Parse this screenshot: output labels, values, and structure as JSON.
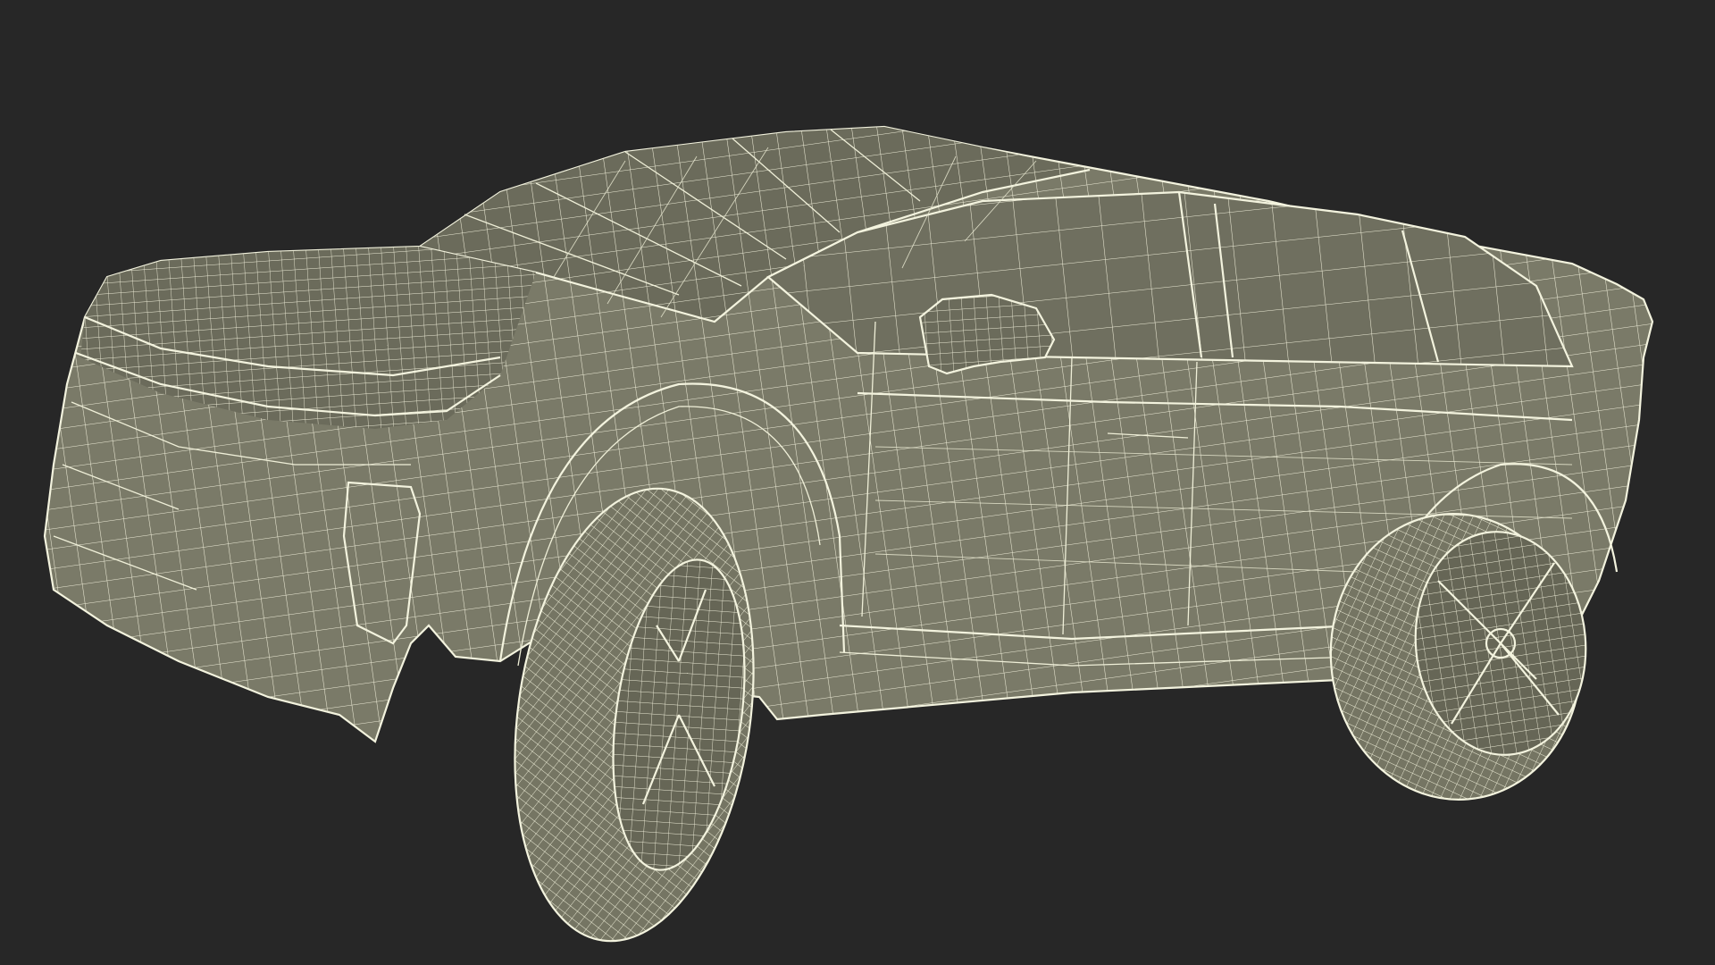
{
  "scene": {
    "subject": "car-wireframe-render",
    "colors": {
      "background": "#272727",
      "body": "#7a7a68",
      "wireframe": "#efefd8",
      "tire": "#757563"
    }
  }
}
